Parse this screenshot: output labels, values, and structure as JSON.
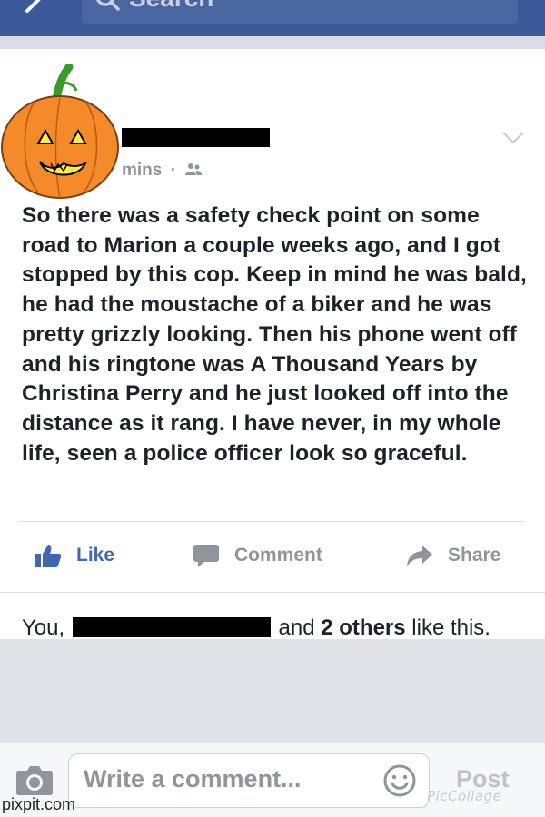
{
  "header": {
    "search_placeholder": "Search"
  },
  "post": {
    "timestamp": "mins",
    "audience_icon": "friends-icon",
    "text": "So there was a safety check point on some road to Marion a couple weeks ago, and I got stopped by this cop. Keep in mind he was bald, he had the moustache of a biker and he was pretty grizzly looking. Then his phone went off and his ringtone was A Thousand Years by Christina Perry and he just looked off into the distance as it rang. I have never, in my whole life, seen a police officer look so graceful."
  },
  "actions": {
    "like": "Like",
    "comment": "Comment",
    "share": "Share"
  },
  "likes": {
    "prefix": "You,",
    "middle": "and",
    "count": "2 others",
    "suffix": "like this."
  },
  "composer": {
    "placeholder": "Write a comment...",
    "post": "Post"
  },
  "watermarks": {
    "left": "pixpit.com",
    "right": "PicCollage"
  },
  "colors": {
    "facebook_blue": "#3b5998",
    "like_blue": "#4267b2",
    "muted_gray": "#90949c",
    "pumpkin_orange": "#f58a2a"
  }
}
